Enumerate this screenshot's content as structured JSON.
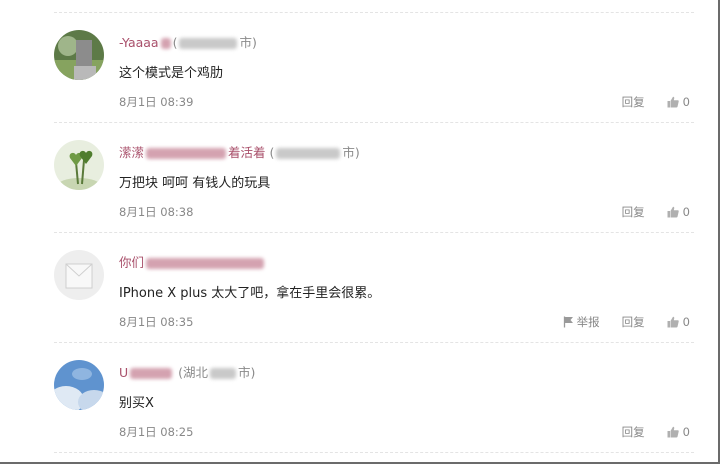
{
  "comments": [
    {
      "user_visible": "-Yaaaa",
      "location_paren_open": "(",
      "location_suffix": "市)",
      "text": "这个模式是个鸡肋",
      "time": "8月1日 08:39",
      "reply_label": "回复",
      "like_count": "0",
      "avatar": "green-photo-avatar"
    },
    {
      "user_visible": "潆潆",
      "user_suffix": "着活着",
      "location_paren_open": "(",
      "location_suffix": "市)",
      "text": "万把块 呵呵 有钱人的玩具",
      "time": "8月1日 08:38",
      "reply_label": "回复",
      "like_count": "0",
      "avatar": "heart-plant-avatar"
    },
    {
      "user_visible": "你们",
      "text": "IPhone X plus 太大了吧，拿在手里会很累。",
      "time": "8月1日 08:35",
      "report_label": "举报",
      "reply_label": "回复",
      "like_count": "0",
      "avatar": "default-grey-avatar"
    },
    {
      "user_visible": "U",
      "location_prefix": "(湖北",
      "location_suffix": "市)",
      "text": "别买X",
      "time": "8月1日 08:25",
      "reply_label": "回复",
      "like_count": "0",
      "avatar": "blue-sky-avatar"
    }
  ],
  "colors": {
    "username": "#a9506b",
    "meta_text": "#888888",
    "body_text": "#222222"
  }
}
